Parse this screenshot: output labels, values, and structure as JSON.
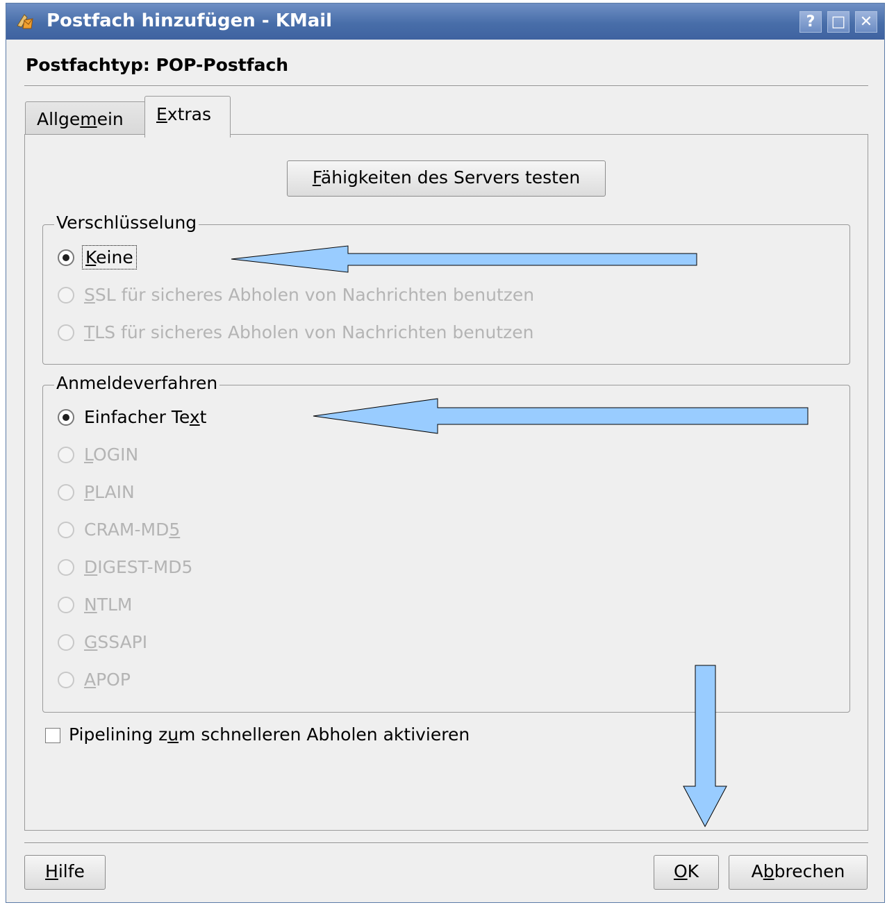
{
  "window": {
    "title": "Postfach hinzufügen - KMail",
    "help_glyph": "?",
    "maximize_glyph": "□",
    "close_glyph": "✕"
  },
  "heading": "Postfachtyp: POP-Postfach",
  "tabs": {
    "general": {
      "label_pre": "Allge",
      "label_mnemonic": "m",
      "label_post": "ein"
    },
    "extras": {
      "label_pre": "",
      "label_mnemonic": "E",
      "label_post": "xtras",
      "active": true
    }
  },
  "test_button": {
    "label_mnemonic": "F",
    "label_post": "ähigkeiten des Servers testen"
  },
  "encryption": {
    "title": "Verschlüsselung",
    "options": [
      {
        "mnemonic": "K",
        "rest": "eine",
        "checked": true,
        "enabled": true
      },
      {
        "mnemonic": "S",
        "rest": "SL für sicheres Abholen von Nachrichten benutzen",
        "checked": false,
        "enabled": false
      },
      {
        "mnemonic": "T",
        "rest": "LS für sicheres Abholen von Nachrichten benutzen",
        "checked": false,
        "enabled": false
      }
    ]
  },
  "auth": {
    "title": "Anmeldeverfahren",
    "options": [
      {
        "pre": "Einfacher Te",
        "mnemonic": "x",
        "post": "t",
        "checked": true,
        "enabled": true
      },
      {
        "pre": "",
        "mnemonic": "L",
        "post": "OGIN",
        "checked": false,
        "enabled": false
      },
      {
        "pre": "",
        "mnemonic": "P",
        "post": "LAIN",
        "checked": false,
        "enabled": false
      },
      {
        "pre": "CRAM-MD",
        "mnemonic": "5",
        "post": "",
        "checked": false,
        "enabled": false
      },
      {
        "pre": "",
        "mnemonic": "D",
        "post": "IGEST-MD5",
        "checked": false,
        "enabled": false
      },
      {
        "pre": "",
        "mnemonic": "N",
        "post": "TLM",
        "checked": false,
        "enabled": false
      },
      {
        "pre": "",
        "mnemonic": "G",
        "post": "SSAPI",
        "checked": false,
        "enabled": false
      },
      {
        "pre": "",
        "mnemonic": "A",
        "post": "POP",
        "checked": false,
        "enabled": false
      }
    ]
  },
  "pipelining": {
    "pre": "Pipelining z",
    "mnemonic": "u",
    "post": "m schnelleren Abholen aktivieren",
    "checked": false
  },
  "buttons": {
    "help": {
      "mnemonic": "H",
      "post": "ilfe"
    },
    "ok": {
      "mnemonic": "O",
      "post": "K"
    },
    "cancel": {
      "pre": "A",
      "mnemonic": "b",
      "post": "brechen"
    }
  },
  "colors": {
    "arrow_fill": "#99ccff",
    "arrow_stroke": "#000000",
    "titlebar": "#486ea9"
  }
}
